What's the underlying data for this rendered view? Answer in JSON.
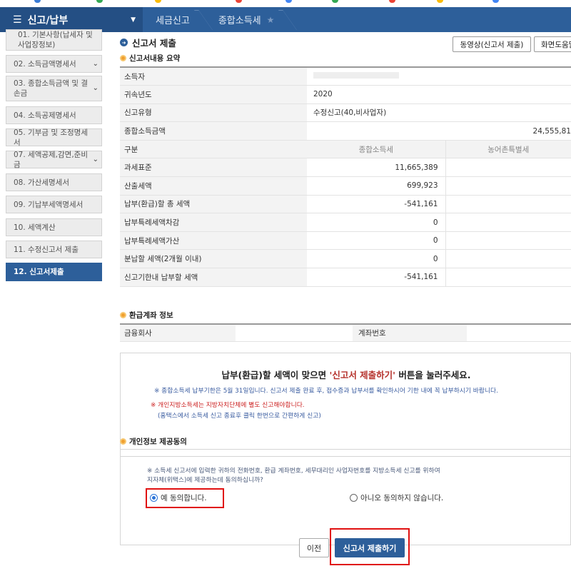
{
  "colors": {
    "nav_bg": "#2d5f9a",
    "active_bg": "#2d5f9a",
    "highlight": "#e01010",
    "accent_red": "#b5302a"
  },
  "nav": {
    "menu_icon": "hamburger-icon",
    "title": "신고/납부",
    "crumbs": [
      "세금신고",
      "종합소득세"
    ],
    "favorite_icon": "star-icon"
  },
  "sidebar": {
    "items": [
      {
        "label": "01. 기본사항(납세자 및 사업장정보)",
        "chevron": false
      },
      {
        "label": "02. 소득금액명세서",
        "chevron": true
      },
      {
        "label": "03. 종합소득금액 및 결손금",
        "chevron": true
      },
      {
        "label": "04. 소득공제명세서",
        "chevron": false
      },
      {
        "label": "05. 기부금 및 조정명세서",
        "chevron": false
      },
      {
        "label": "07. 세액공제,감면,준비금",
        "chevron": true
      },
      {
        "label": "08. 가산세명세서",
        "chevron": false
      },
      {
        "label": "09. 기납부세액명세서",
        "chevron": false
      },
      {
        "label": "10. 세액계산",
        "chevron": false
      },
      {
        "label": "11. 수정신고서 제출",
        "chevron": false
      },
      {
        "label": "12. 신고서제출",
        "chevron": false
      }
    ]
  },
  "main": {
    "page_title": "신고서 제출",
    "buttons": {
      "video_guide": "동영상(신고서 제출)",
      "screen_help": "화면도움말"
    },
    "summary": {
      "title": "신고서내용 요약",
      "rows": [
        {
          "label": "소득자",
          "value": ""
        },
        {
          "label": "귀속년도",
          "value": "2020"
        },
        {
          "label": "신고유형",
          "value": "수정신고(40,비사업자)"
        },
        {
          "label": "종합소득금액",
          "value": "24,555,81"
        }
      ],
      "tax_header": {
        "label": "구분",
        "col1": "종합소득세",
        "col2": "농어촌특별세"
      },
      "tax_rows": [
        {
          "label": "과세표준",
          "v1": "11,665,389",
          "v2": ""
        },
        {
          "label": "산출세액",
          "v1": "699,923",
          "v2": ""
        },
        {
          "label": "납부(환급)할 총 세액",
          "v1": "-541,161",
          "v2": ""
        },
        {
          "label": "납부특례세액차감",
          "v1": "0",
          "v2": ""
        },
        {
          "label": "납부특례세액가산",
          "v1": "0",
          "v2": ""
        },
        {
          "label": "분납할 세액(2개월 이내)",
          "v1": "0",
          "v2": ""
        },
        {
          "label": "신고기한내 납부할 세액",
          "v1": "-541,161",
          "v2": ""
        }
      ]
    },
    "refund": {
      "title": "환급계좌 정보",
      "bank_label": "금융회사",
      "bank_value": "",
      "account_label": "계좌번호",
      "account_value": ""
    },
    "notice": {
      "big_pre": "납부(환급)할 세액이 맞으면 ",
      "big_red": "'신고서 제출하기'",
      "big_post": " 버튼을 눌러주세요.",
      "line1": "※ 종합소득세 납부기한은 5월 31일입니다. 신고서 제출 완료 후, 접수증과 납부서를 확인하시어 기한 내에 꼭 납부하시기 바랍니다.",
      "line2": "※ 개인지방소득세는 지방자치단체에 별도 신고해야합니다.",
      "line3": "(홈택스에서 소득세 신고 종료후 클릭 한번으로 간편하게 신고)"
    },
    "consent": {
      "title": "개인정보 제공동의",
      "text1": "※ 소득세 신고서에 입력한 귀하의 전화번호, 환급 계좌번호, 세무대리인 사업자번호를 지방소득세 신고를 위하여",
      "text2": "지자체(위택스)에 제공하는데 동의하십니까?",
      "agree": "예 동의합니다.",
      "disagree": "아니오 동의하지 않습니다.",
      "selected": "agree"
    },
    "actions": {
      "prev": "이전",
      "submit": "신고서 제출하기"
    }
  }
}
